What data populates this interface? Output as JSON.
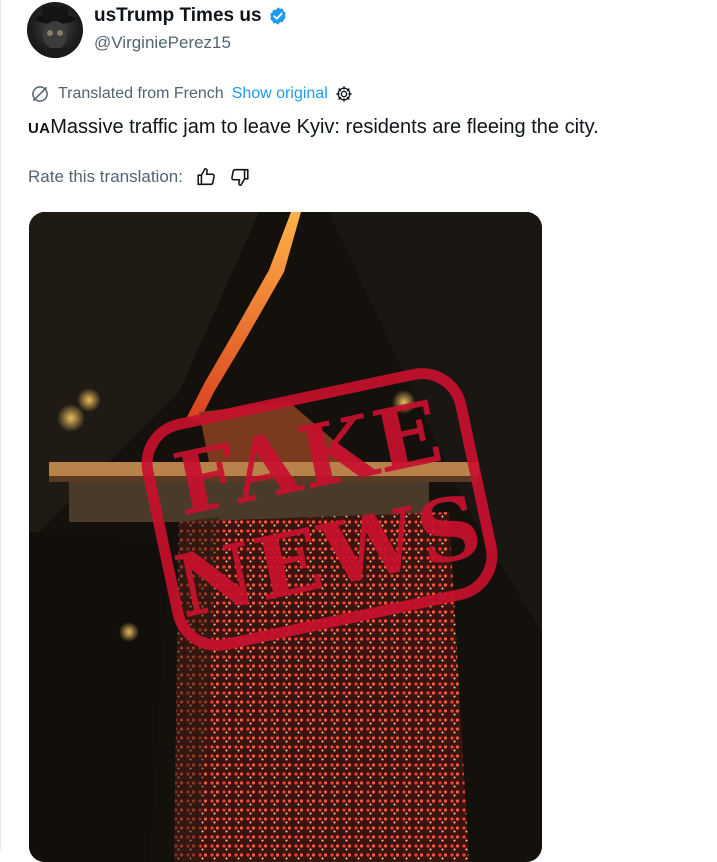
{
  "tweet": {
    "display_name": "usTrump Times us",
    "handle": "@VirginiePerez15",
    "verified_icon": "verified-badge-icon",
    "translation_notice": "Translated from French",
    "show_original_label": "Show original",
    "flag_code": "UA",
    "text": "Massive traffic jam to leave Kyiv: residents are fleeing the city.",
    "rate_label": "Rate this translation:",
    "stamp_line1": "FAKE",
    "stamp_line2": "NEWS"
  },
  "icons": {
    "translate": "translate-globe-icon",
    "settings": "gear-icon",
    "thumbs_up": "thumbs-up-icon",
    "thumbs_down": "thumbs-down-icon"
  },
  "colors": {
    "verified_blue": "#1d9bf0",
    "link_blue": "#1d9bf0",
    "secondary_text": "#536471",
    "stamp_red": "#c8102e"
  }
}
